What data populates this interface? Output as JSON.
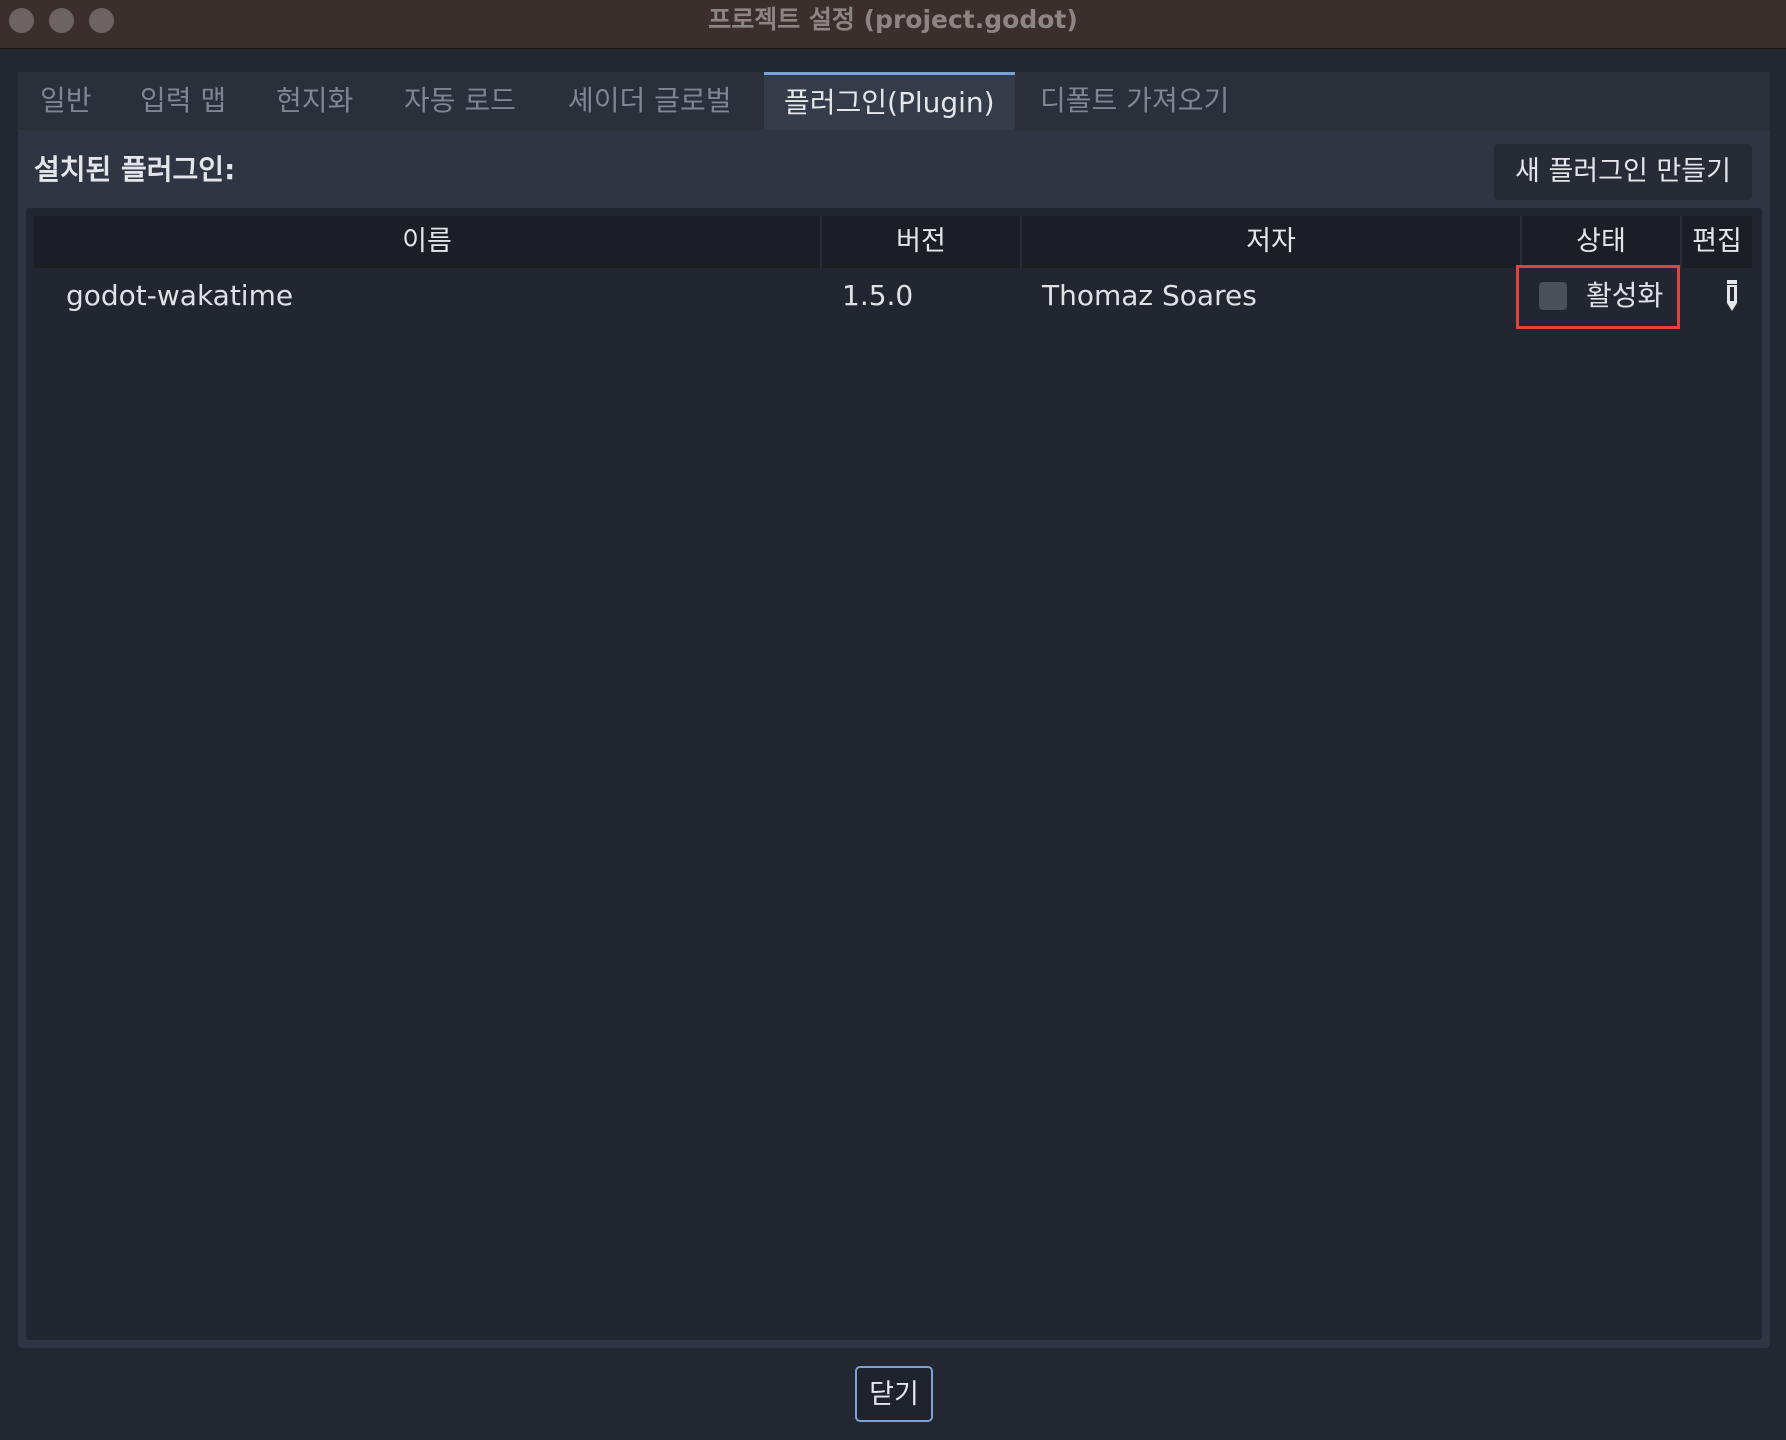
{
  "window": {
    "title": "프로젝트 설정 (project.godot)"
  },
  "tabs": [
    {
      "label": "일반"
    },
    {
      "label": "입력 맵"
    },
    {
      "label": "현지화"
    },
    {
      "label": "자동 로드"
    },
    {
      "label": "셰이더 글로벌"
    },
    {
      "label": "플러그인(Plugin)",
      "active": true
    },
    {
      "label": "디폴트 가져오기"
    }
  ],
  "plugins": {
    "section_label": "설치된 플러그인:",
    "new_plugin_button": "새 플러그인 만들기",
    "columns": [
      "이름",
      "버전",
      "저자",
      "상태",
      "편집"
    ],
    "rows": [
      {
        "name": "godot-wakatime",
        "version": "1.5.0",
        "author": "Thomaz Soares",
        "status_label": "활성화",
        "enabled": false,
        "edit_icon": "pencil-icon"
      }
    ]
  },
  "footer": {
    "close_button": "닫기"
  },
  "colors": {
    "accent": "#7aa1d8",
    "highlight_box": "#e0453a",
    "titlebar": "#3a2f2c"
  }
}
